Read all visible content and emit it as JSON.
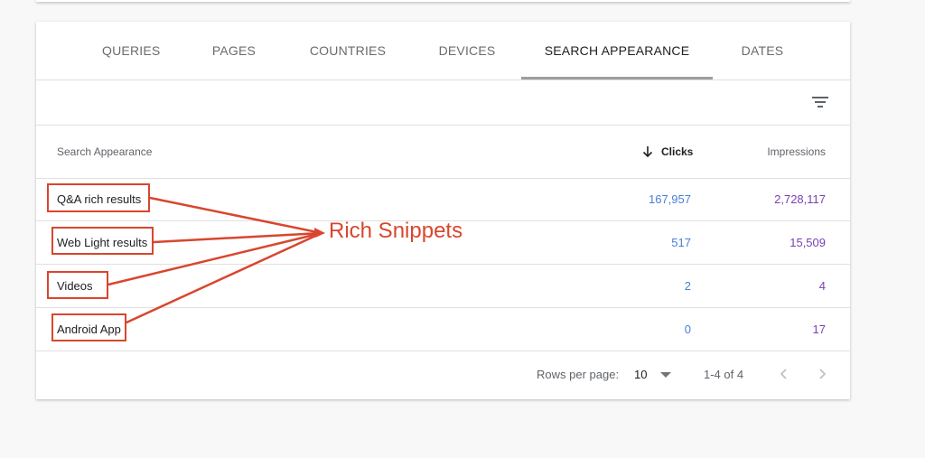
{
  "tabs": [
    {
      "label": "QUERIES"
    },
    {
      "label": "PAGES"
    },
    {
      "label": "COUNTRIES"
    },
    {
      "label": "DEVICES"
    },
    {
      "label": "SEARCH APPEARANCE",
      "active": true
    },
    {
      "label": "DATES"
    }
  ],
  "toolbar": {
    "filter_icon": "filter-icon"
  },
  "table": {
    "columns": {
      "name": "Search Appearance",
      "clicks": "Clicks",
      "impressions": "Impressions",
      "sort_icon": "arrow-down-icon"
    },
    "rows": [
      {
        "name": "Q&A rich results",
        "clicks": "167,957",
        "impressions": "2,728,117"
      },
      {
        "name": "Web Light results",
        "clicks": "517",
        "impressions": "15,509"
      },
      {
        "name": "Videos",
        "clicks": "2",
        "impressions": "4"
      },
      {
        "name": "Android App",
        "clicks": "0",
        "impressions": "17"
      }
    ]
  },
  "pagination": {
    "rows_per_page_label": "Rows per page:",
    "rows_per_page_value": "10",
    "range": "1-4 of 4"
  },
  "annotation": {
    "label": "Rich Snippets",
    "color": "#d9462e"
  },
  "colors": {
    "clicks": "#4a7ed8",
    "impressions": "#7b3fb3",
    "tab_indicator": "#9e9e9e"
  }
}
